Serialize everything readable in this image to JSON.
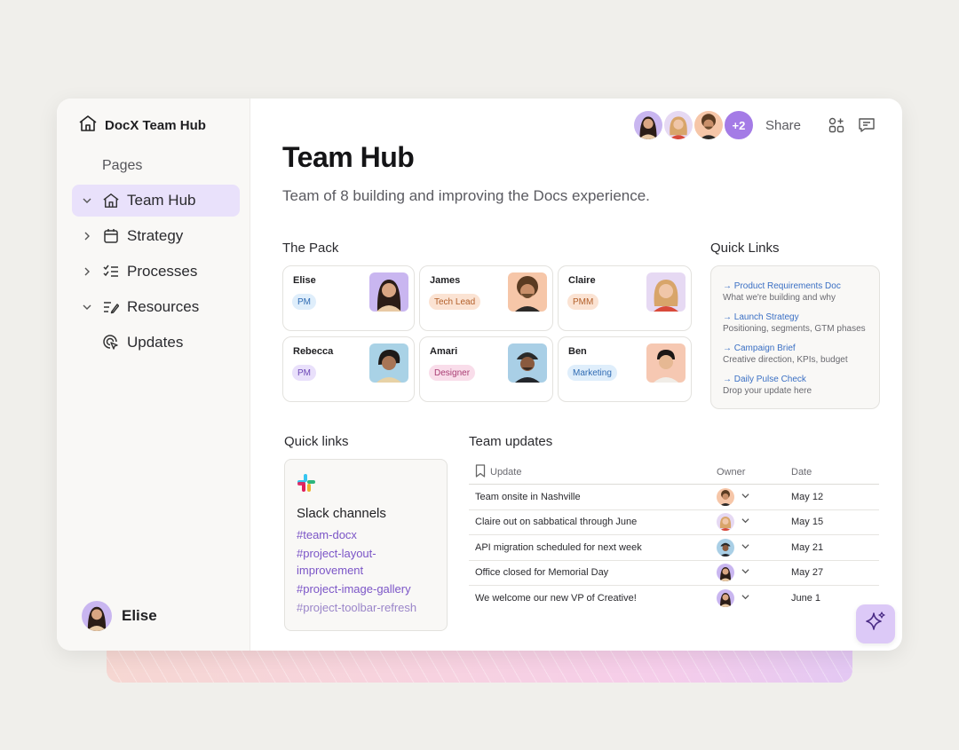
{
  "app": {
    "name": "DocX Team Hub"
  },
  "sidebar": {
    "section_label": "Pages",
    "items": [
      {
        "label": "Team Hub",
        "icon": "home-icon",
        "expanded": true,
        "active": true
      },
      {
        "label": "Strategy",
        "icon": "calendar-icon",
        "expanded": false
      },
      {
        "label": "Processes",
        "icon": "checklist-icon",
        "expanded": false
      },
      {
        "label": "Resources",
        "icon": "edit-list-icon",
        "expanded": true
      },
      {
        "label": "Updates",
        "icon": "cursor-click-icon",
        "child": true
      }
    ],
    "user": {
      "name": "Elise"
    }
  },
  "topbar": {
    "extra_count": "+2",
    "share_label": "Share"
  },
  "page": {
    "title": "Team Hub",
    "subtitle": "Team of 8 building and improving the Docs experience."
  },
  "pack": {
    "label": "The Pack",
    "members": [
      {
        "name": "Elise",
        "role": "PM",
        "chip_bg": "#dfeefb",
        "chip_fg": "#2f6bb3"
      },
      {
        "name": "James",
        "role": "Tech Lead",
        "chip_bg": "#fbe3d3",
        "chip_fg": "#b3602b"
      },
      {
        "name": "Claire",
        "role": "PMM",
        "chip_bg": "#fbe3d3",
        "chip_fg": "#b3602b"
      },
      {
        "name": "Rebecca",
        "role": "PM",
        "chip_bg": "#e9e0fb",
        "chip_fg": "#6b46b5"
      },
      {
        "name": "Amari",
        "role": "Designer",
        "chip_bg": "#f9ddea",
        "chip_fg": "#a93d73"
      },
      {
        "name": "Ben",
        "role": "Marketing",
        "chip_bg": "#dfeefb",
        "chip_fg": "#2f6bb3"
      }
    ]
  },
  "quick_links_top": {
    "label": "Quick Links",
    "items": [
      {
        "link": "→ Product Requirements Doc",
        "desc": "What we're building and why"
      },
      {
        "link": "→ Launch Strategy",
        "desc": "Positioning, segments, GTM phases"
      },
      {
        "link": "→ Campaign Brief",
        "desc": "Creative direction, KPIs, budget"
      },
      {
        "link": "→ Daily Pulse Check",
        "desc": "Drop your update here"
      }
    ]
  },
  "quick_links_bottom": {
    "label": "Quick links",
    "slack_title": "Slack channels",
    "channels": [
      "#team-docx",
      "#project-layout-improvement",
      "#project-image-gallery",
      "#project-toolbar-refresh"
    ]
  },
  "team_updates": {
    "label": "Team updates",
    "headers": {
      "update": "Update",
      "owner": "Owner",
      "date": "Date"
    },
    "rows": [
      {
        "update": "Team onsite in Nashville",
        "date": "May 12"
      },
      {
        "update": "Claire out on sabbatical through June",
        "date": "May 15"
      },
      {
        "update": "API migration scheduled for next week",
        "date": "May 21"
      },
      {
        "update": "Office closed for Memorial Day",
        "date": "May 27"
      },
      {
        "update": "We welcome our new VP of Creative!",
        "date": "June 1"
      }
    ]
  },
  "colors": {
    "accent": "#a47be6",
    "active_nav": "#e9e1fb",
    "link": "#3a6fc4",
    "slack_channel": "#7b55c7"
  }
}
